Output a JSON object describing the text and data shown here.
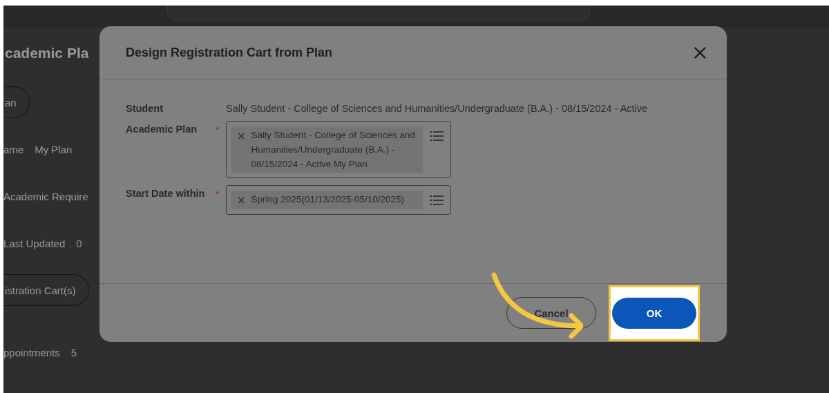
{
  "background_page": {
    "title": "cademic Pla",
    "items": [
      {
        "kind": "button",
        "label": "an"
      },
      {
        "kind": "field",
        "label": "ame",
        "value": "My Plan"
      },
      {
        "kind": "text",
        "label": "Academic Require"
      },
      {
        "kind": "field",
        "label": "Last Updated",
        "value": "0"
      },
      {
        "kind": "button",
        "label": "istration Cart(s)"
      },
      {
        "kind": "field",
        "label": "ppointments",
        "value": "5"
      }
    ]
  },
  "dialog": {
    "title": "Design Registration Cart from Plan",
    "close": "×",
    "required_mark": "*",
    "remove": "×",
    "fields": [
      {
        "kind": "text",
        "label": "Student",
        "required": false,
        "value": "Sally Student - College of Sciences and Humanities/Undergraduate (B.A.) - 08/15/2024 - Active"
      },
      {
        "kind": "prompt",
        "label": "Academic Plan",
        "required": true,
        "value": "Sally Student - College of Sciences and Humanities/Undergraduate (B.A.) - 08/15/2024 - Active My Plan"
      },
      {
        "kind": "prompt",
        "label": "Start Date within",
        "required": true,
        "value": "Spring 2025(01/13/2025-05/10/2025)"
      }
    ],
    "buttons": [
      {
        "kind": "secondary",
        "label": "Cancel",
        "highlighted": false
      },
      {
        "kind": "primary",
        "label": "OK",
        "highlighted": true
      }
    ]
  }
}
